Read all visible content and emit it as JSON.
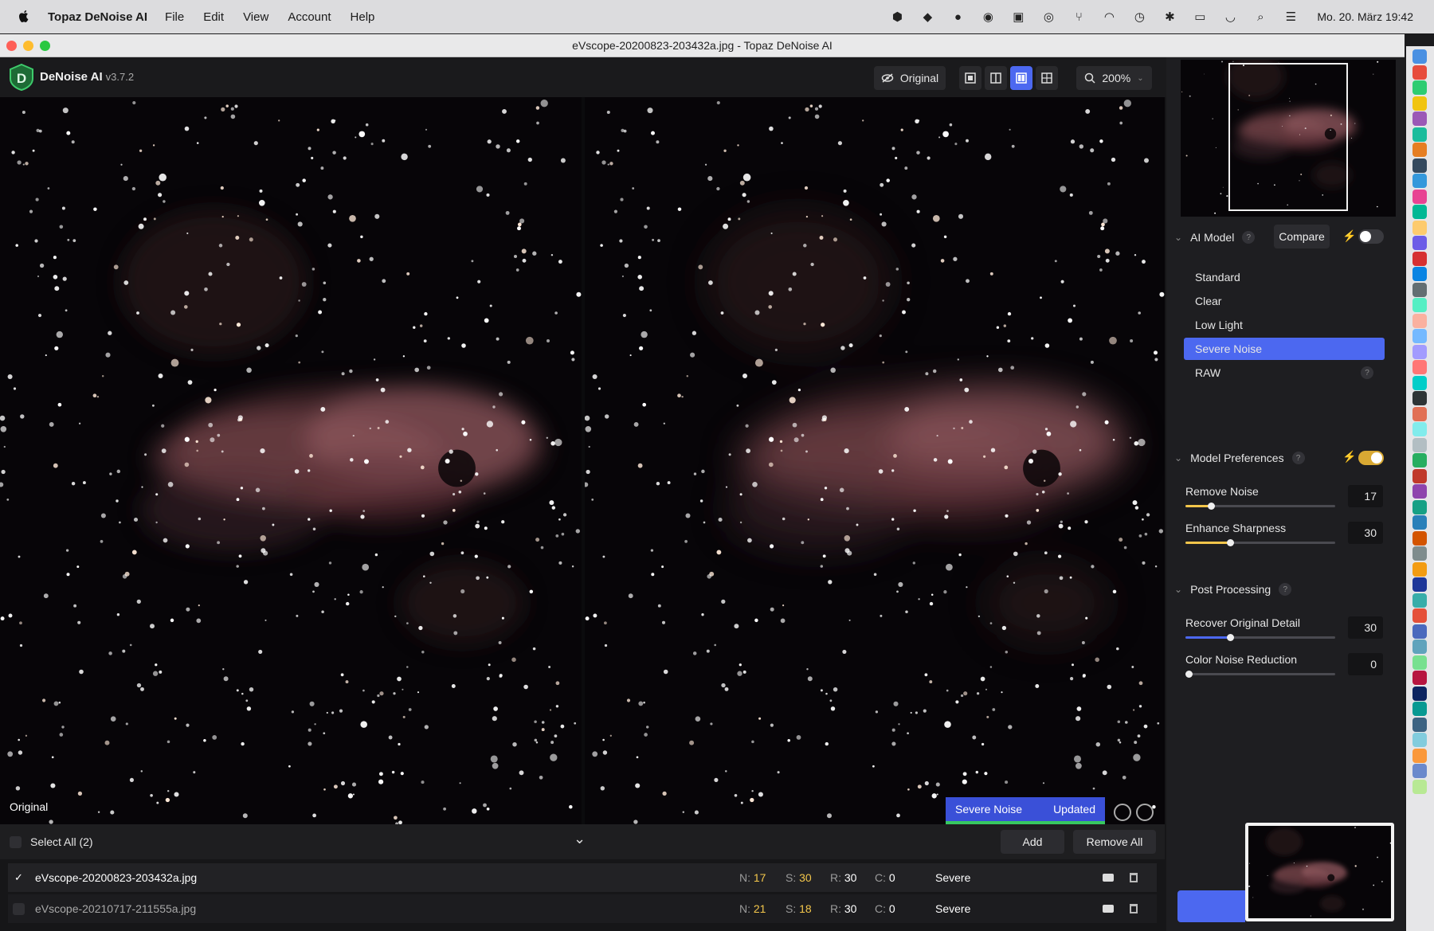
{
  "menubar": {
    "app_name": "Topaz DeNoise AI",
    "items": [
      "File",
      "Edit",
      "View",
      "Account",
      "Help"
    ],
    "datetime": "Mo. 20. März  19:42"
  },
  "window": {
    "title": "eVscope-20200823-203432a.jpg - Topaz DeNoise AI"
  },
  "header": {
    "brand": "DeNoise AI",
    "version": "v3.7.2",
    "original_button": "Original",
    "zoom": "200%",
    "active_view": "side-by-side"
  },
  "preview": {
    "left_label": "Original",
    "model_badge": "Severe Noise",
    "status_badge": "Updated"
  },
  "filelist": {
    "select_all": "Select All (2)",
    "add_label": "Add",
    "remove_all_label": "Remove All",
    "rows": [
      {
        "name": "eVscope-20200823-203432a.jpg",
        "checked": true,
        "n_label": "N:",
        "n": "17",
        "s_label": "S:",
        "s": "30",
        "r_label": "R:",
        "r": "30",
        "c_label": "C:",
        "c": "0",
        "model": "Severe"
      },
      {
        "name": "eVscope-20210717-211555a.jpg",
        "checked": false,
        "n_label": "N:",
        "n": "21",
        "s_label": "S:",
        "s": "18",
        "r_label": "R:",
        "r": "30",
        "c_label": "C:",
        "c": "0",
        "model": "Severe"
      }
    ]
  },
  "panel": {
    "ai_model": {
      "title": "AI Model",
      "compare_label": "Compare",
      "compare_enabled": false,
      "models": [
        "Standard",
        "Clear",
        "Low Light",
        "Severe Noise",
        "RAW"
      ],
      "selected": "Severe Noise"
    },
    "model_prefs": {
      "title": "Model Preferences",
      "auto_enabled": true,
      "sliders": [
        {
          "label": "Remove Noise",
          "value": "17",
          "fraction": 0.17
        },
        {
          "label": "Enhance Sharpness",
          "value": "30",
          "fraction": 0.3
        }
      ]
    },
    "post_processing": {
      "title": "Post Processing",
      "sliders": [
        {
          "label": "Recover Original Detail",
          "value": "30",
          "fraction": 0.3
        },
        {
          "label": "Color Noise Reduction",
          "value": "0",
          "fraction": 0.0
        }
      ]
    }
  },
  "colors": {
    "accent": "#4c68f0",
    "highlight": "#f3c64b",
    "success": "#37c860"
  }
}
